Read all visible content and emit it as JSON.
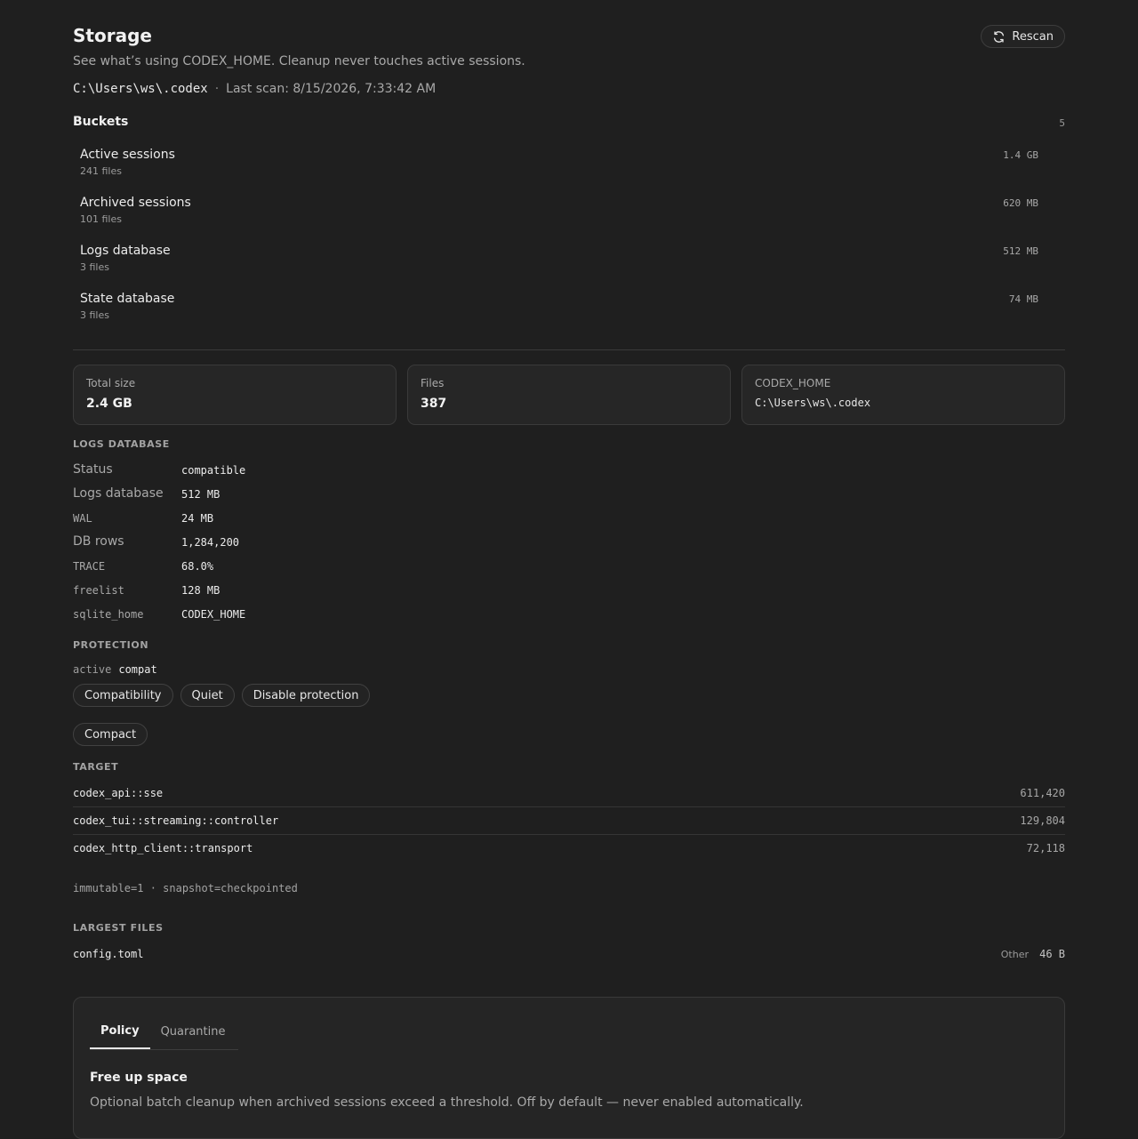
{
  "header": {
    "title": "Storage",
    "subtitle": "See what’s using CODEX_HOME. Cleanup never touches active sessions.",
    "path": "C:\\Users\\ws\\.codex",
    "separator": "·",
    "last_scan": "Last scan: 8/15/2026, 7:33:42 AM",
    "rescan_label": "Rescan",
    "rescan_icon": "refresh-icon"
  },
  "buckets": {
    "title": "Buckets",
    "count": "5",
    "items": [
      {
        "name": "Active sessions",
        "files": "241 files",
        "size": "1.4 GB"
      },
      {
        "name": "Archived sessions",
        "files": "101 files",
        "size": "620 MB"
      },
      {
        "name": "Logs database",
        "files": "3 files",
        "size": "512 MB"
      },
      {
        "name": "State database",
        "files": "3 files",
        "size": "74 MB"
      }
    ]
  },
  "stats": [
    {
      "label": "Total size",
      "value": "2.4 GB"
    },
    {
      "label": "Files",
      "value": "387"
    },
    {
      "label": "CODEX_HOME",
      "value": "C:\\Users\\ws\\.codex"
    }
  ],
  "logs_db": {
    "heading": "LOGS DATABASE",
    "rows": [
      {
        "key": "Status",
        "value": "compatible"
      },
      {
        "key": "Logs database",
        "value": "512 MB"
      },
      {
        "key": "WAL",
        "value": "24 MB"
      },
      {
        "key": "DB rows",
        "value": "1,284,200"
      },
      {
        "key": "TRACE",
        "value": "68.0%"
      },
      {
        "key": "freelist",
        "value": "128 MB"
      },
      {
        "key": "sqlite_home",
        "value": "CODEX_HOME"
      }
    ]
  },
  "protection": {
    "heading": "PROTECTION",
    "active_key": "active",
    "active_value": "compat",
    "buttons": [
      "Compatibility",
      "Quiet",
      "Disable protection"
    ],
    "compact_label": "Compact"
  },
  "target": {
    "heading": "TARGET",
    "rows": [
      {
        "name": "codex_api::sse",
        "count": "611,420"
      },
      {
        "name": "codex_tui::streaming::controller",
        "count": "129,804"
      },
      {
        "name": "codex_http_client::transport",
        "count": "72,118"
      }
    ],
    "meta": "immutable=1 · snapshot=checkpointed"
  },
  "largest_files": {
    "heading": "LARGEST FILES",
    "items": [
      {
        "name": "config.toml",
        "kind": "Other",
        "size": "46 B"
      }
    ]
  },
  "panel": {
    "tabs": [
      "Policy",
      "Quarantine"
    ],
    "heading": "Free up space",
    "description": "Optional batch cleanup when archived sessions exceed a threshold. Off by default — never enabled automatically."
  }
}
